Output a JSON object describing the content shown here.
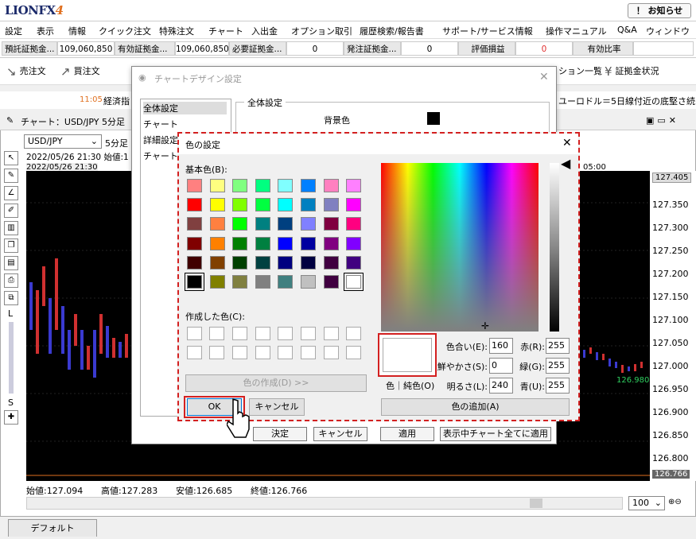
{
  "app": {
    "logo": "LIONFX",
    "logo_num": "4",
    "news_button": "！ お知らせ"
  },
  "menu": [
    "設定",
    "表示",
    "情報",
    "クイック注文",
    "特殊注文",
    "チャート",
    "入出金",
    "オプション取引",
    "履歴検索/報告書",
    "サポート/サービス情報",
    "操作マニュアル",
    "Q&A",
    "ウィンドウ"
  ],
  "account": {
    "items": [
      {
        "label": "預託証拠金...",
        "value": "109,060,850"
      },
      {
        "label": "有効証拠金...",
        "value": "109,060,850"
      },
      {
        "label": "必要証拠金...",
        "value": "0"
      },
      {
        "label": "発注証拠金...",
        "value": "0"
      },
      {
        "label": "評価損益",
        "value": "0"
      },
      {
        "label": "有効比率",
        "value": ""
      }
    ]
  },
  "toolbar": {
    "sell": "売注文",
    "buy": "買注文",
    "position_list": "ション一覧",
    "margin_status": "証拠金状況"
  },
  "ticker": {
    "time": "11:05",
    "text": "経済指",
    "news": "ユーロドル＝5日線付近の底堅さ続"
  },
  "chart": {
    "title": "チャート：USD/JPY 5分足",
    "symbol": "USD/JPY",
    "period": "5分足",
    "info_line": "2022/05/26 21:30  始値:1",
    "date_header": "2022/05/26 21:30",
    "time_label": "05:00",
    "y_labels": [
      "127.405",
      "127.350",
      "127.300",
      "127.250",
      "127.200",
      "127.150",
      "127.100",
      "127.050",
      "127.000",
      "126.950",
      "126.900",
      "126.850",
      "126.800",
      "126.766"
    ],
    "last_label": "126.980",
    "ohlc": {
      "open": "始値:127.094",
      "high": "高値:127.283",
      "low": "安値:126.685",
      "close": "終値:126.766"
    },
    "zoom": "100",
    "bottom_tab": "デフォルト",
    "left_labels": {
      "l": "L",
      "s": "S"
    }
  },
  "design_dialog": {
    "title": "チャートデザイン設定",
    "list": [
      "全体設定",
      "チャート",
      "詳細設定",
      "チャート"
    ],
    "group_title": "全体設定",
    "bg_label": "背景色",
    "buttons": {
      "ok": "決定",
      "cancel": "キャンセル",
      "apply": "適用",
      "apply_all": "表示中チャート全てに適用"
    }
  },
  "color_dialog": {
    "title": "色の設定",
    "basic_label": "基本色(B):",
    "custom_label": "作成した色(C):",
    "define_button": "色の作成(D) >>",
    "ok": "OK",
    "cancel": "キャンセル",
    "add_button": "色の追加(A)",
    "solid_label": "色｜純色(O)",
    "fields": [
      {
        "label": "色合い(E):",
        "value": "160"
      },
      {
        "label": "鮮やかさ(S):",
        "value": "0"
      },
      {
        "label": "明るさ(L):",
        "value": "240"
      },
      {
        "label": "赤(R):",
        "value": "255"
      },
      {
        "label": "緑(G):",
        "value": "255"
      },
      {
        "label": "青(U):",
        "value": "255"
      }
    ],
    "basic_colors": [
      "#ff8080",
      "#ffff80",
      "#80ff80",
      "#00ff80",
      "#80ffff",
      "#0080ff",
      "#ff80c0",
      "#ff80ff",
      "#ff0000",
      "#ffff00",
      "#80ff00",
      "#00ff40",
      "#00ffff",
      "#0080c0",
      "#8080c0",
      "#ff00ff",
      "#804040",
      "#ff8040",
      "#00ff00",
      "#008080",
      "#004080",
      "#8080ff",
      "#800040",
      "#ff0080",
      "#800000",
      "#ff8000",
      "#008000",
      "#008040",
      "#0000ff",
      "#0000a0",
      "#800080",
      "#8000ff",
      "#400000",
      "#804000",
      "#004000",
      "#004040",
      "#000080",
      "#000040",
      "#400040",
      "#400080",
      "#000000",
      "#808000",
      "#808040",
      "#808080",
      "#408080",
      "#c0c0c0",
      "#400040",
      "#ffffff"
    ],
    "selected_color": "#ffffff"
  }
}
